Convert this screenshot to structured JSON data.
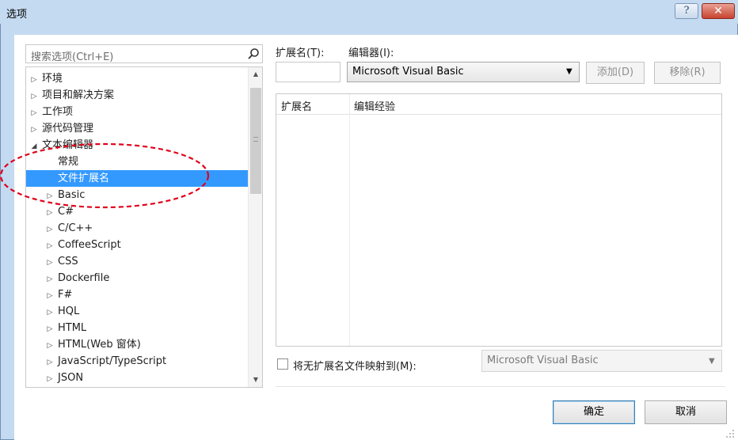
{
  "window": {
    "title": "选项",
    "help_label": "?",
    "close_label": "✕"
  },
  "search": {
    "placeholder": "搜索选项(Ctrl+E)",
    "icon": "search-icon"
  },
  "tree": {
    "rows": [
      {
        "label": "环境",
        "arrow": "▷",
        "indent": 0
      },
      {
        "label": "项目和解决方案",
        "arrow": "▷",
        "indent": 0
      },
      {
        "label": "工作项",
        "arrow": "▷",
        "indent": 0
      },
      {
        "label": "源代码管理",
        "arrow": "▷",
        "indent": 0
      },
      {
        "label": "文本编辑器",
        "arrow": "◢",
        "indent": 0
      },
      {
        "label": "常规",
        "arrow": "",
        "indent": 1
      },
      {
        "label": "文件扩展名",
        "arrow": "",
        "indent": 1,
        "selected": true
      },
      {
        "label": "Basic",
        "arrow": "▷",
        "indent": 1
      },
      {
        "label": "C#",
        "arrow": "▷",
        "indent": 1
      },
      {
        "label": "C/C++",
        "arrow": "▷",
        "indent": 1
      },
      {
        "label": "CoffeeScript",
        "arrow": "▷",
        "indent": 1
      },
      {
        "label": "CSS",
        "arrow": "▷",
        "indent": 1
      },
      {
        "label": "Dockerfile",
        "arrow": "▷",
        "indent": 1
      },
      {
        "label": "F#",
        "arrow": "▷",
        "indent": 1
      },
      {
        "label": "HQL",
        "arrow": "▷",
        "indent": 1
      },
      {
        "label": "HTML",
        "arrow": "▷",
        "indent": 1
      },
      {
        "label": "HTML(Web 窗体)",
        "arrow": "▷",
        "indent": 1
      },
      {
        "label": "JavaScript/TypeScript",
        "arrow": "▷",
        "indent": 1
      },
      {
        "label": "JSON",
        "arrow": "▷",
        "indent": 1
      }
    ]
  },
  "right": {
    "ext_label": "扩展名(T):",
    "editor_label": "编辑器(I):",
    "ext_value": "",
    "editor_value": "Microsoft Visual Basic",
    "add_label": "添加(D)",
    "remove_label": "移除(R)",
    "grid_col_ext": "扩展名",
    "grid_col_exp": "编辑经验",
    "map_label": "将无扩展名文件映射到(M):",
    "map_value": "Microsoft Visual Basic",
    "map_checked": false
  },
  "footer": {
    "ok_label": "确定",
    "cancel_label": "取消"
  },
  "colors": {
    "selection": "#3399ff",
    "annotation": "#e0001a",
    "title_bar": "#c4daf1"
  }
}
